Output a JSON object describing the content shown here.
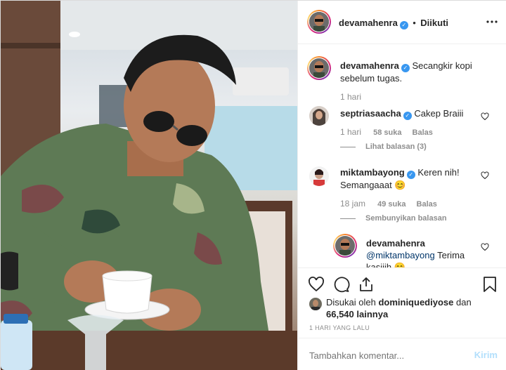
{
  "header": {
    "username": "devamahenra",
    "dot": "•",
    "follow_status": "Diikuti",
    "more_icon": "more-horizontal-icon"
  },
  "caption": {
    "username": "devamahenra",
    "text": "Secangkir kopi sebelum tugas.",
    "time": "1 hari"
  },
  "comments": [
    {
      "username": "septriasaacha",
      "text": "Cakep Braiii",
      "time": "1 hari",
      "likes": "58 suka",
      "reply": "Balas",
      "thread": "Lihat balasan (3)"
    },
    {
      "username": "miktambayong",
      "text": "Keren nih! Semangaaat 😊",
      "time": "18 jam",
      "likes": "49 suka",
      "reply": "Balas",
      "thread": "Sembunyikan balasan"
    },
    {
      "username": "devamahenra",
      "mention": "@miktambayong",
      "text": " Terima kasiiih 😊"
    }
  ],
  "likes": {
    "prefix": "Disukai oleh",
    "user": "dominiquediyose",
    "and": "dan",
    "others": "66,540 lainnya"
  },
  "timestamp": "1 HARI YANG LALU",
  "add_comment": {
    "placeholder": "Tambahkan komentar...",
    "submit": "Kirim"
  },
  "colors": {
    "verified": "#3897f0",
    "submit_disabled": "#b2dffc"
  }
}
